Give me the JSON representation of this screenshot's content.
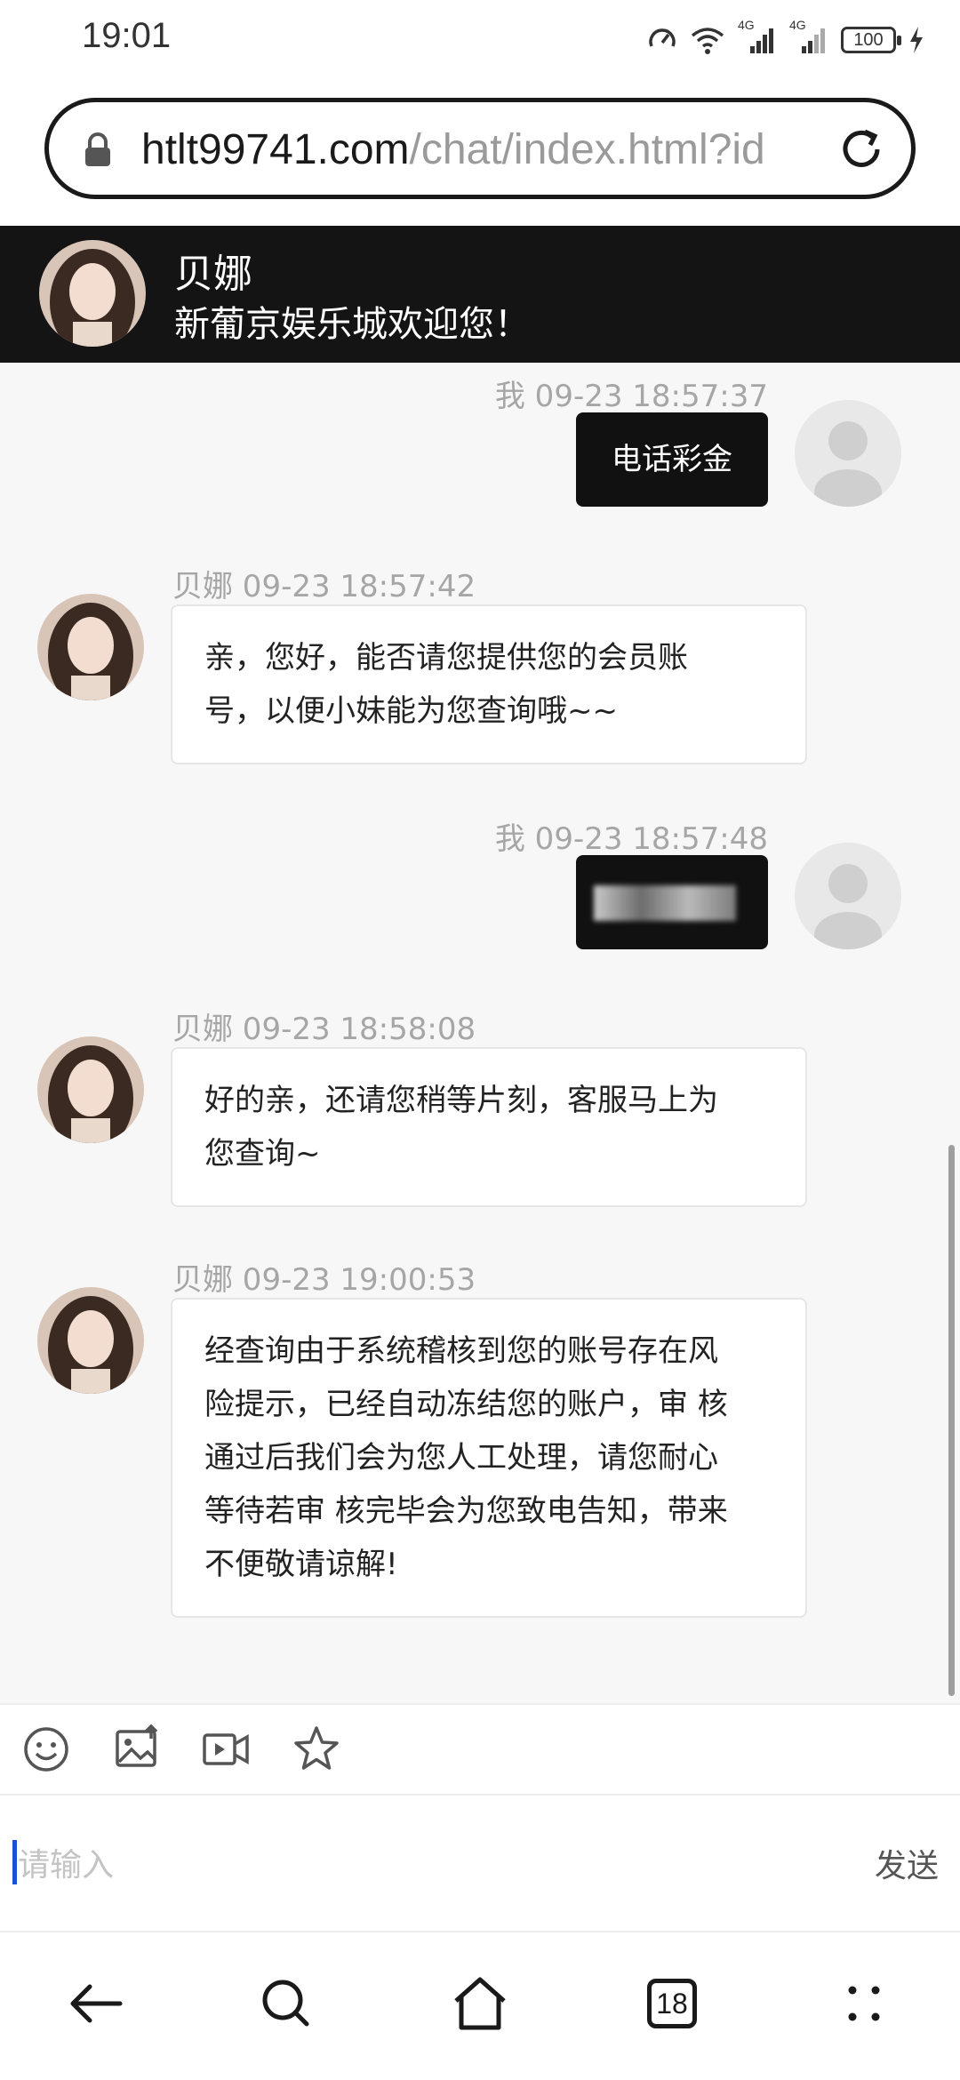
{
  "status_bar": {
    "time": "19:01",
    "battery": "100",
    "network_1": "4G",
    "network_2": "4G"
  },
  "browser": {
    "url_host": "htlt99741.com",
    "url_path": "/chat/index.html?id"
  },
  "header": {
    "name": "贝娜",
    "welcome": "新葡京娱乐城欢迎您！"
  },
  "messages": [
    {
      "sender": "user",
      "meta": "我 09-23 18:57:37",
      "text": "电话彩金"
    },
    {
      "sender": "agent",
      "meta": "贝娜  09-23 18:57:42",
      "lines": [
        "亲，您好，能否请您提供您的会员账",
        "号，以便小妹能为您查询哦~~"
      ]
    },
    {
      "sender": "user",
      "meta": "我 09-23 18:57:48",
      "text": ""
    },
    {
      "sender": "agent",
      "meta": "贝娜  09-23 18:58:08",
      "lines": [
        "好的亲，还请您稍等片刻，客服马上为",
        "您查询~"
      ]
    },
    {
      "sender": "agent",
      "meta": "贝娜  09-23 19:00:53",
      "lines": [
        "经查询由于系统稽核到您的账号存在风",
        "险提示，已经自动冻结您的账户，审 核",
        "通过后我们会为您人工处理，请您耐心",
        "等待若审 核完毕会为您致电告知，带来",
        "不便敬请谅解!"
      ]
    }
  ],
  "toolbar": {
    "icons": [
      "emoji-icon",
      "image-upload-icon",
      "video-icon",
      "star-icon"
    ]
  },
  "input": {
    "placeholder": "请输入",
    "send_label": "发送"
  },
  "bottom_nav": {
    "tabs_count": "18"
  }
}
